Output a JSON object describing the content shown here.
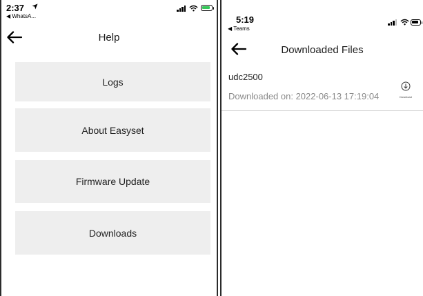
{
  "left_screen": {
    "status_bar": {
      "time": "2:37",
      "back_app": "◀ WhatsA..."
    },
    "header": {
      "title": "Help"
    },
    "menu_items": [
      {
        "label": "Logs"
      },
      {
        "label": "About Easyset"
      },
      {
        "label": "Firmware Update"
      },
      {
        "label": "Downloads"
      }
    ],
    "colors": {
      "button_bg": "#eeeeee",
      "battery_charging": "#35c759"
    }
  },
  "right_screen": {
    "status_bar": {
      "time": "5:19",
      "back_app": "◀ Teams"
    },
    "header": {
      "title": "Downloaded Files"
    },
    "files": [
      {
        "name": "udc2500",
        "downloaded": "Downloaded on: 2022-06-13 17:19:04",
        "action_label": "Download"
      }
    ]
  }
}
